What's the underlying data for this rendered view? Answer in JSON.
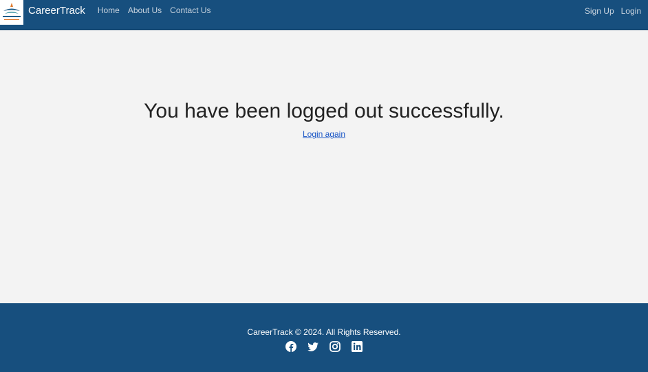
{
  "nav": {
    "brand": "CareerTrack",
    "links": [
      "Home",
      "About Us",
      "Contact Us"
    ],
    "right": [
      "Sign Up",
      "Login"
    ]
  },
  "main": {
    "heading": "You have been logged out successfully.",
    "link": "Login again"
  },
  "footer": {
    "copyright": "CareerTrack © 2024. All Rights Reserved.",
    "socials": [
      "facebook-icon",
      "twitter-icon",
      "instagram-icon",
      "linkedin-icon"
    ]
  },
  "colors": {
    "nav_bg": "#174f7e",
    "page_bg": "#f3f3f3",
    "link": "#1a56c6"
  }
}
